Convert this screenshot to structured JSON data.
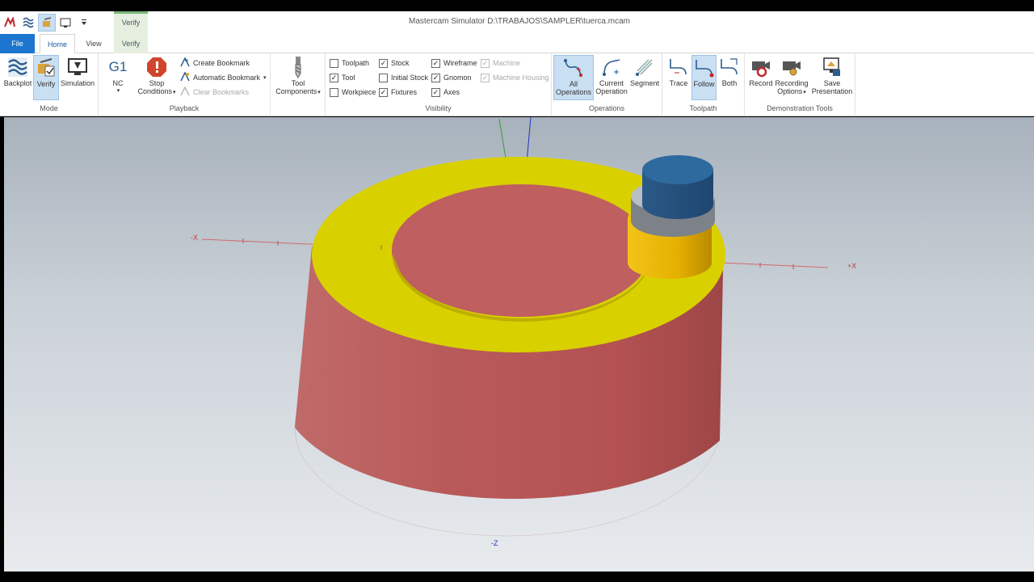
{
  "window": {
    "title": "Mastercam Simulator  D:\\TRABAJOS\\SAMPLER\\tuerca.mcam"
  },
  "context_tab": {
    "label": "Verify"
  },
  "tabs": {
    "file": "File",
    "home": "Home",
    "view": "View",
    "verify": "Verify"
  },
  "ribbon": {
    "mode": {
      "label": "Mode",
      "backplot": "Backplot",
      "verify": "Verify",
      "simulation": "Simulation"
    },
    "playback": {
      "label": "Playback",
      "nc_glyph": "G1",
      "nc": "NC",
      "stop_conditions_1": "Stop",
      "stop_conditions_2": "Conditions",
      "create_bookmark": "Create Bookmark",
      "automatic_bookmark": "Automatic Bookmark",
      "clear_bookmarks": "Clear Bookmarks"
    },
    "tool_components": {
      "line1": "Tool",
      "line2": "Components"
    },
    "visibility": {
      "label": "Visibility",
      "toolpath": "Toolpath",
      "tool": "Tool",
      "workpiece": "Workpiece",
      "stock": "Stock",
      "initial_stock": "Initial Stock",
      "fixtures": "Fixtures",
      "wireframe": "Wireframe",
      "gnomon": "Gnomon",
      "axes": "Axes",
      "machine": "Machine",
      "machine_housing": "Machine Housing",
      "checked": {
        "toolpath": false,
        "tool": true,
        "workpiece": false,
        "stock": true,
        "initial_stock": false,
        "fixtures": true,
        "wireframe": true,
        "gnomon": true,
        "axes": true,
        "machine": true,
        "machine_housing": true
      }
    },
    "operations": {
      "label": "Operations",
      "all_1": "All",
      "all_2": "Operations",
      "current_1": "Current",
      "current_2": "Operation",
      "segment": "Segment"
    },
    "toolpath": {
      "label": "Toolpath",
      "trace": "Trace",
      "follow": "Follow",
      "both": "Both"
    },
    "demo": {
      "label": "Demonstration Tools",
      "record": "Record",
      "recording_1": "Recording",
      "recording_2": "Options",
      "save_1": "Save",
      "save_2": "Presentation"
    }
  },
  "viewport": {
    "axis_minus_x": "-X",
    "axis_plus_x": "+X",
    "axis_minus_z": "-Z",
    "colors": {
      "stock_side": "#b95a5a",
      "stock_top_ring": "#d7d000",
      "tool_holder": "#2f5d8c",
      "tool_collar": "#8a8f96",
      "tool_body": "#e7b400"
    }
  }
}
